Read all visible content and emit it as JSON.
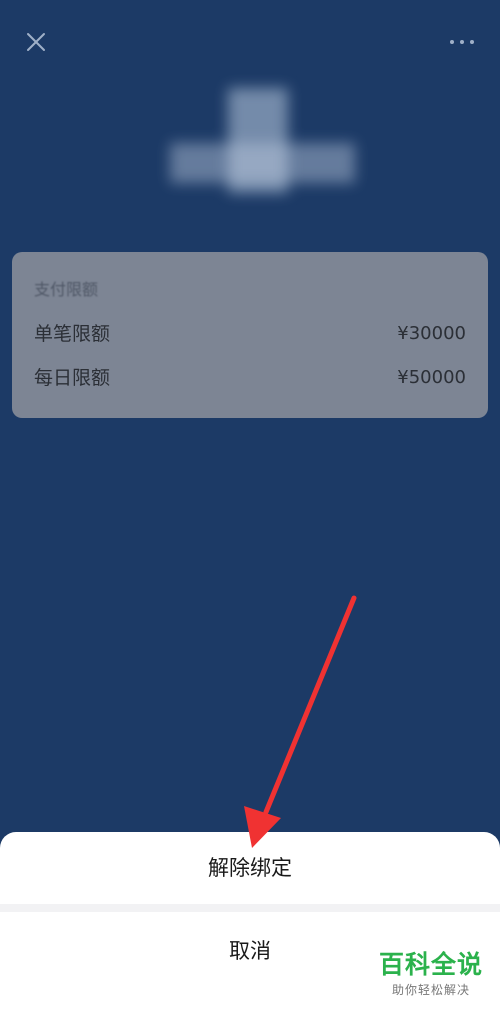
{
  "header": {
    "close_icon": "close-icon",
    "more_icon": "more-dots-icon"
  },
  "limit_card": {
    "title": "支付限额",
    "rows": [
      {
        "label": "单笔限额",
        "value": "¥30000"
      },
      {
        "label": "每日限额",
        "value": "¥50000"
      }
    ]
  },
  "action_sheet": {
    "unbind_label": "解除绑定",
    "cancel_label": "取消"
  },
  "watermark": {
    "title": "百科全说",
    "subtitle": "助你轻松解决"
  },
  "colors": {
    "background": "#1c3a66",
    "annotation_arrow": "#f03232",
    "watermark_green": "#2bb24c"
  }
}
